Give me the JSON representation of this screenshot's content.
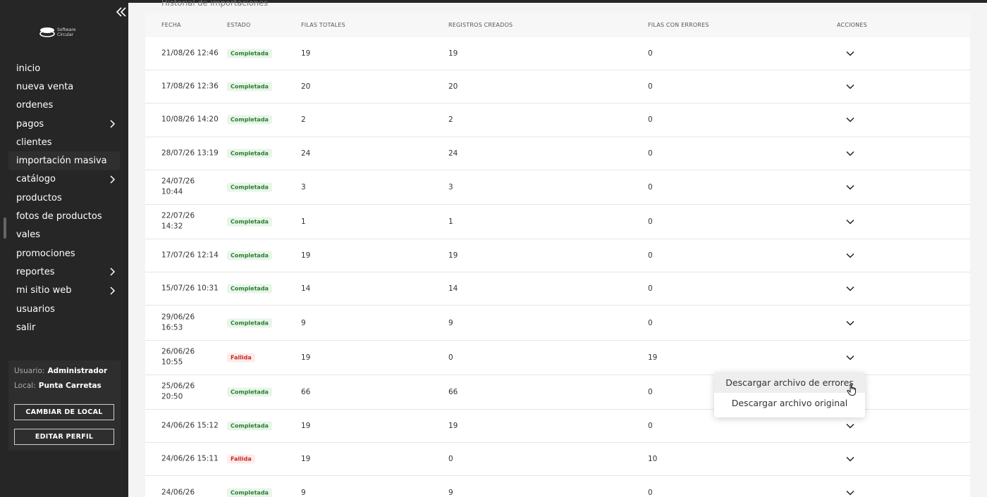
{
  "sidebar": {
    "logo_text": [
      "Software",
      "Circular"
    ],
    "items": [
      {
        "label": "inicio",
        "has_submenu": false
      },
      {
        "label": "nueva venta",
        "has_submenu": false
      },
      {
        "label": "ordenes",
        "has_submenu": false
      },
      {
        "label": "pagos",
        "has_submenu": true
      },
      {
        "label": "clientes",
        "has_submenu": false
      },
      {
        "label": "importación masiva",
        "has_submenu": false,
        "active": true
      },
      {
        "label": "catálogo",
        "has_submenu": true
      },
      {
        "label": "productos",
        "has_submenu": false
      },
      {
        "label": "fotos de productos",
        "has_submenu": false
      },
      {
        "label": "vales",
        "has_submenu": false
      },
      {
        "label": "promociones",
        "has_submenu": false
      },
      {
        "label": "reportes",
        "has_submenu": true
      },
      {
        "label": "mi sitio web",
        "has_submenu": true
      },
      {
        "label": "usuarios",
        "has_submenu": false
      },
      {
        "label": "salir",
        "has_submenu": false
      }
    ],
    "user": {
      "usuario_label": "Usuario:",
      "usuario_value": "Administrador",
      "local_label": "Local:",
      "local_value": "Punta Carretas",
      "change_local_button": "CAMBIAR DE LOCAL",
      "edit_profile_button": "EDITAR PERFIL"
    }
  },
  "main": {
    "section_title": "Historial de importaciones",
    "table": {
      "headers": [
        "FECHA",
        "ESTADO",
        "FILAS TOTALES",
        "REGISTROS CREADOS",
        "FILAS CON ERRORES",
        "ACCIONES"
      ],
      "rows": [
        {
          "fecha": [
            "21/08/26 12:46"
          ],
          "estado": "Completada",
          "status": "ok",
          "filas_totales": "19",
          "registros_creados": "19",
          "filas_con_errores": "0"
        },
        {
          "fecha": [
            "17/08/26 12:36"
          ],
          "estado": "Completada",
          "status": "ok",
          "filas_totales": "20",
          "registros_creados": "20",
          "filas_con_errores": "0"
        },
        {
          "fecha": [
            "10/08/26 14:20"
          ],
          "estado": "Completada",
          "status": "ok",
          "filas_totales": "2",
          "registros_creados": "2",
          "filas_con_errores": "0"
        },
        {
          "fecha": [
            "28/07/26 13:19"
          ],
          "estado": "Completada",
          "status": "ok",
          "filas_totales": "24",
          "registros_creados": "24",
          "filas_con_errores": "0"
        },
        {
          "fecha": [
            "24/07/26",
            "10:44"
          ],
          "estado": "Completada",
          "status": "ok",
          "filas_totales": "3",
          "registros_creados": "3",
          "filas_con_errores": "0"
        },
        {
          "fecha": [
            "22/07/26",
            "14:32"
          ],
          "estado": "Completada",
          "status": "ok",
          "filas_totales": "1",
          "registros_creados": "1",
          "filas_con_errores": "0"
        },
        {
          "fecha": [
            "17/07/26 12:14"
          ],
          "estado": "Completada",
          "status": "ok",
          "filas_totales": "19",
          "registros_creados": "19",
          "filas_con_errores": "0"
        },
        {
          "fecha": [
            "15/07/26 10:31"
          ],
          "estado": "Completada",
          "status": "ok",
          "filas_totales": "14",
          "registros_creados": "14",
          "filas_con_errores": "0"
        },
        {
          "fecha": [
            "29/06/26",
            "16:53"
          ],
          "estado": "Completada",
          "status": "ok",
          "filas_totales": "9",
          "registros_creados": "9",
          "filas_con_errores": "0"
        },
        {
          "fecha": [
            "26/06/26",
            "10:55"
          ],
          "estado": "Fallida",
          "status": "fail",
          "filas_totales": "19",
          "registros_creados": "0",
          "filas_con_errores": "19"
        },
        {
          "fecha": [
            "25/06/26",
            "20:50"
          ],
          "estado": "Completada",
          "status": "ok",
          "filas_totales": "66",
          "registros_creados": "66",
          "filas_con_errores": "0"
        },
        {
          "fecha": [
            "24/06/26 15:12"
          ],
          "estado": "Completada",
          "status": "ok",
          "filas_totales": "19",
          "registros_creados": "19",
          "filas_con_errores": "0"
        },
        {
          "fecha": [
            "24/06/26 15:11"
          ],
          "estado": "Fallida",
          "status": "fail",
          "filas_totales": "19",
          "registros_creados": "0",
          "filas_con_errores": "10"
        },
        {
          "fecha": [
            "24/06/26"
          ],
          "estado": "Completada",
          "status": "ok",
          "filas_totales": "9",
          "registros_creados": "9",
          "filas_con_errores": "0"
        }
      ]
    },
    "dropdown": {
      "items": [
        "Descargar archivo de errores",
        "Descargar archivo original"
      ],
      "hovered_index": 0
    }
  },
  "colors": {
    "sidebar_bg": "#262626",
    "success_text": "#2e7d32",
    "success_bg": "#e8f5e9",
    "fail_text": "#c62828",
    "fail_bg": "#fdecea"
  },
  "icons": {
    "collapse": "double-chevron-left-icon",
    "submenu": "chevron-right-icon",
    "row_action": "chevron-down-icon",
    "cursor": "hand-pointer-icon"
  }
}
